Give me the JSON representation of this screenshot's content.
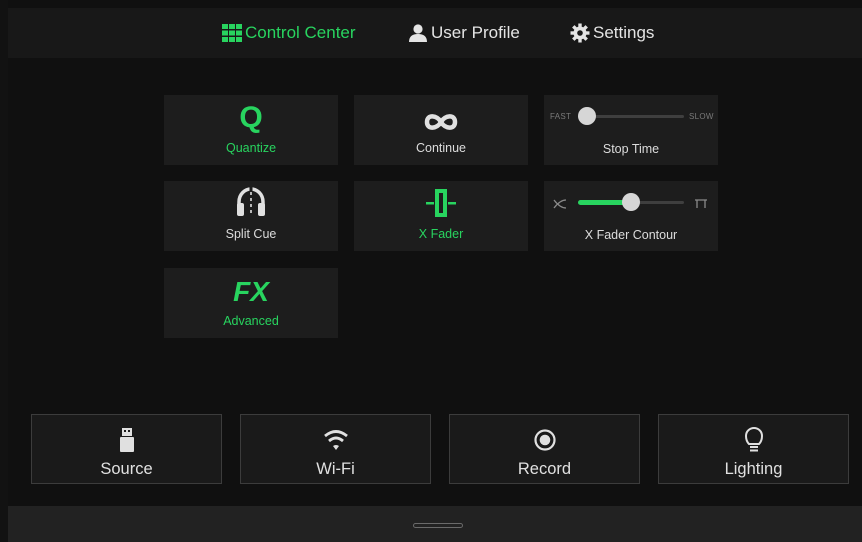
{
  "header": {
    "tabs": [
      {
        "label": "Control Center",
        "icon": "grid-icon",
        "active": true
      },
      {
        "label": "User Profile",
        "icon": "user-icon",
        "active": false
      },
      {
        "label": "Settings",
        "icon": "gear-icon",
        "active": false
      }
    ]
  },
  "tiles": {
    "quantize": {
      "glyph": "Q",
      "label": "Quantize",
      "active": true,
      "icon": "quantize-icon"
    },
    "continue": {
      "label": "Continue",
      "active": false,
      "icon": "infinity-icon"
    },
    "stop_time": {
      "label": "Stop Time",
      "min_label": "FAST",
      "max_label": "SLOW",
      "value": 0.0
    },
    "split_cue": {
      "label": "Split Cue",
      "active": false,
      "icon": "headphones-icon"
    },
    "x_fader": {
      "label": "X Fader",
      "active": true,
      "icon": "crossfader-icon"
    },
    "x_fader_contour": {
      "label": "X Fader Contour",
      "min_icon": "cross-curve-icon",
      "max_icon": "cut-curve-icon",
      "value": 0.48
    },
    "advanced": {
      "glyph": "FX",
      "label": "Advanced",
      "active": true,
      "icon": "fx-icon"
    }
  },
  "bottom_buttons": [
    {
      "label": "Source",
      "icon": "usb-icon"
    },
    {
      "label": "Wi-Fi",
      "icon": "wifi-icon"
    },
    {
      "label": "Record",
      "icon": "record-icon"
    },
    {
      "label": "Lighting",
      "icon": "bulb-icon"
    }
  ],
  "colors": {
    "accent": "#28d45f",
    "background": "#111111",
    "tile": "#1d1d1d",
    "text": "#dcdcdc"
  }
}
